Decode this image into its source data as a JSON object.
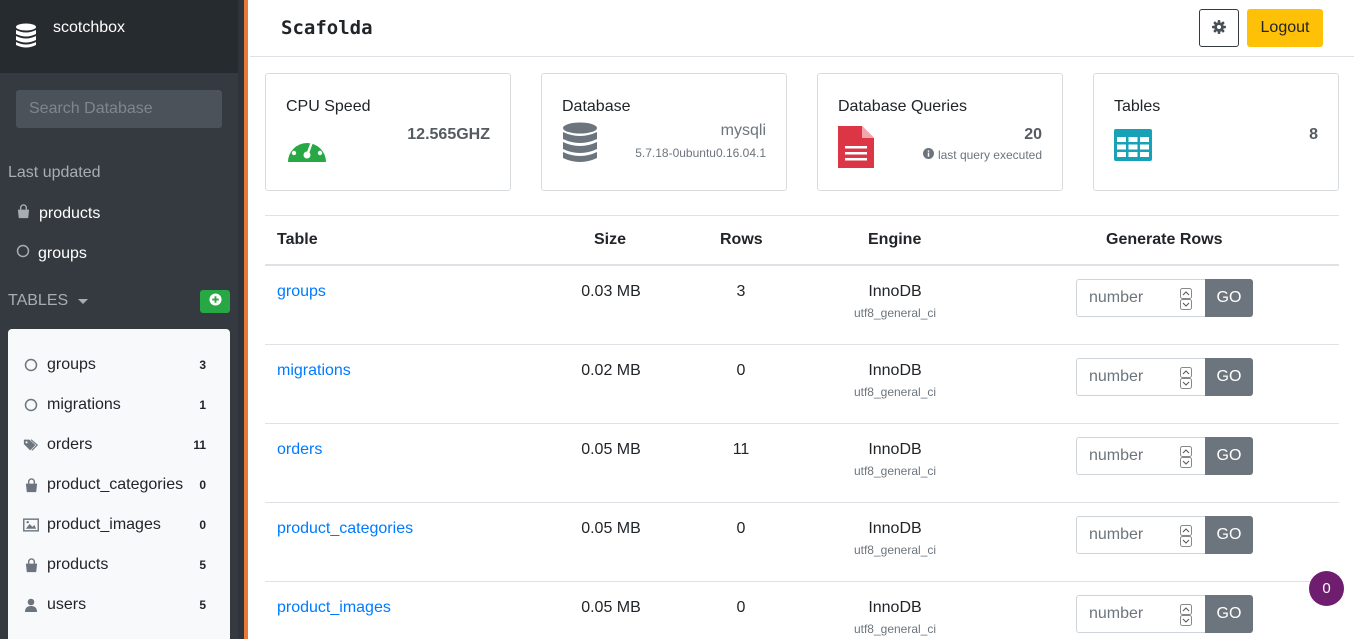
{
  "sidebar": {
    "brand": "scotchbox",
    "search_placeholder": "Search Database",
    "last_updated_label": "Last updated",
    "last_updated": [
      {
        "label": "products",
        "icon": "shopping-bag-icon"
      },
      {
        "label": "groups",
        "icon": "circle-outline-icon"
      }
    ],
    "tables_label": "TABLES",
    "tables": [
      {
        "label": "groups",
        "count": "3",
        "icon": "circle-outline-icon"
      },
      {
        "label": "migrations",
        "count": "1",
        "icon": "circle-outline-icon"
      },
      {
        "label": "orders",
        "count": "11",
        "icon": "tags-icon"
      },
      {
        "label": "product_categories",
        "count": "0",
        "icon": "shopping-bag-icon"
      },
      {
        "label": "product_images",
        "count": "0",
        "icon": "image-icon"
      },
      {
        "label": "products",
        "count": "5",
        "icon": "shopping-bag-icon"
      },
      {
        "label": "users",
        "count": "5",
        "icon": "user-icon"
      }
    ]
  },
  "header": {
    "title": "Scafolda",
    "logout_label": "Logout"
  },
  "cards": {
    "cpu": {
      "title": "CPU Speed",
      "value": "12.565GHZ",
      "icon": "dashboard-gauge-icon",
      "color": "#28a745"
    },
    "database": {
      "title": "Database",
      "value": "mysqli",
      "sub": "5.7.18-0ubuntu0.16.04.1",
      "icon": "database-icon",
      "color": "#6c757d"
    },
    "queries": {
      "title": "Database Queries",
      "value": "20",
      "sub": "last query executed",
      "icon": "file-text-icon",
      "color": "#dc3545"
    },
    "tables": {
      "title": "Tables",
      "value": "8",
      "icon": "table-icon",
      "color": "#17a2b8"
    }
  },
  "table": {
    "headers": {
      "table": "Table",
      "size": "Size",
      "rows": "Rows",
      "engine": "Engine",
      "generate": "Generate Rows"
    },
    "input_placeholder": "number",
    "go_label": "GO",
    "rows": [
      {
        "name": "groups",
        "size": "0.03 MB",
        "rows": "3",
        "engine": "InnoDB",
        "collation": "utf8_general_ci"
      },
      {
        "name": "migrations",
        "size": "0.02 MB",
        "rows": "0",
        "engine": "InnoDB",
        "collation": "utf8_general_ci"
      },
      {
        "name": "orders",
        "size": "0.05 MB",
        "rows": "11",
        "engine": "InnoDB",
        "collation": "utf8_general_ci"
      },
      {
        "name": "product_categories",
        "size": "0.05 MB",
        "rows": "0",
        "engine": "InnoDB",
        "collation": "utf8_general_ci"
      },
      {
        "name": "product_images",
        "size": "0.05 MB",
        "rows": "0",
        "engine": "InnoDB",
        "collation": "utf8_general_ci"
      }
    ]
  },
  "notification_badge": "0",
  "colors": {
    "sidebar_bg": "#343a40",
    "accent": "#e8773a",
    "link": "#007bff",
    "logout": "#ffc107",
    "badge": "#6f1d6f"
  }
}
